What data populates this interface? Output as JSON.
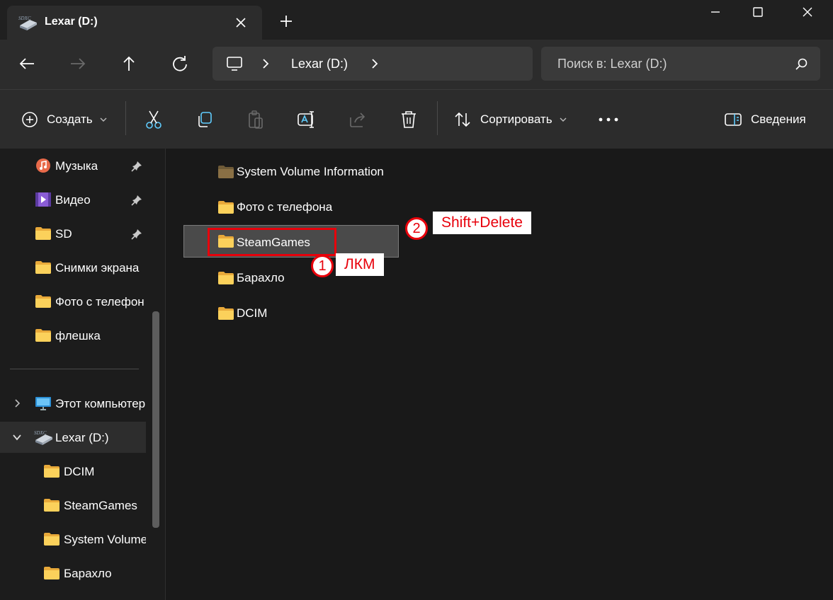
{
  "tab": {
    "title": "Lexar (D:)",
    "close_icon": "close-icon",
    "new_tab_icon": "plus-icon"
  },
  "window": {
    "minimize_icon": "minimize-icon",
    "maximize_icon": "maximize-icon",
    "close_icon": "close-icon"
  },
  "nav": {
    "back_icon": "arrow-left-icon",
    "forward_icon": "arrow-right-icon",
    "up_icon": "arrow-up-icon",
    "refresh_icon": "refresh-icon"
  },
  "address": {
    "path": "Lexar (D:)"
  },
  "search": {
    "placeholder": "Поиск в: Lexar (D:)"
  },
  "toolbar": {
    "create_label": "Создать",
    "sort_label": "Сортировать",
    "details_label": "Сведения"
  },
  "sidebar": {
    "quick": [
      {
        "label": "Музыка",
        "icon": "music-icon",
        "pinned": true
      },
      {
        "label": "Видео",
        "icon": "video-icon",
        "pinned": true
      },
      {
        "label": "SD",
        "icon": "folder-icon",
        "pinned": true
      },
      {
        "label": "Снимки экрана",
        "icon": "folder-icon"
      },
      {
        "label": "Фото с телефон",
        "icon": "folder-icon"
      },
      {
        "label": "флешка",
        "icon": "folder-icon"
      }
    ],
    "this_pc": "Этот компьютер",
    "drive": "Lexar (D:)",
    "drive_children": [
      "DCIM",
      "SteamGames",
      "System Volume",
      "Барахло"
    ]
  },
  "files": [
    {
      "name": "System Volume Information",
      "icon": "system-folder-icon"
    },
    {
      "name": "Фото с телефона",
      "icon": "folder-icon"
    },
    {
      "name": "SteamGames",
      "icon": "folder-icon",
      "selected": true
    },
    {
      "name": "Барахло",
      "icon": "folder-icon"
    },
    {
      "name": "DCIM",
      "icon": "folder-icon"
    }
  ],
  "annotations": {
    "step1_number": "1",
    "step1_text": "ЛКМ",
    "step2_number": "2",
    "step2_text": "Shift+Delete"
  },
  "colors": {
    "accent": "#e8000b",
    "folder": "#f7c948",
    "selected_bg": "#4a4a4a"
  }
}
